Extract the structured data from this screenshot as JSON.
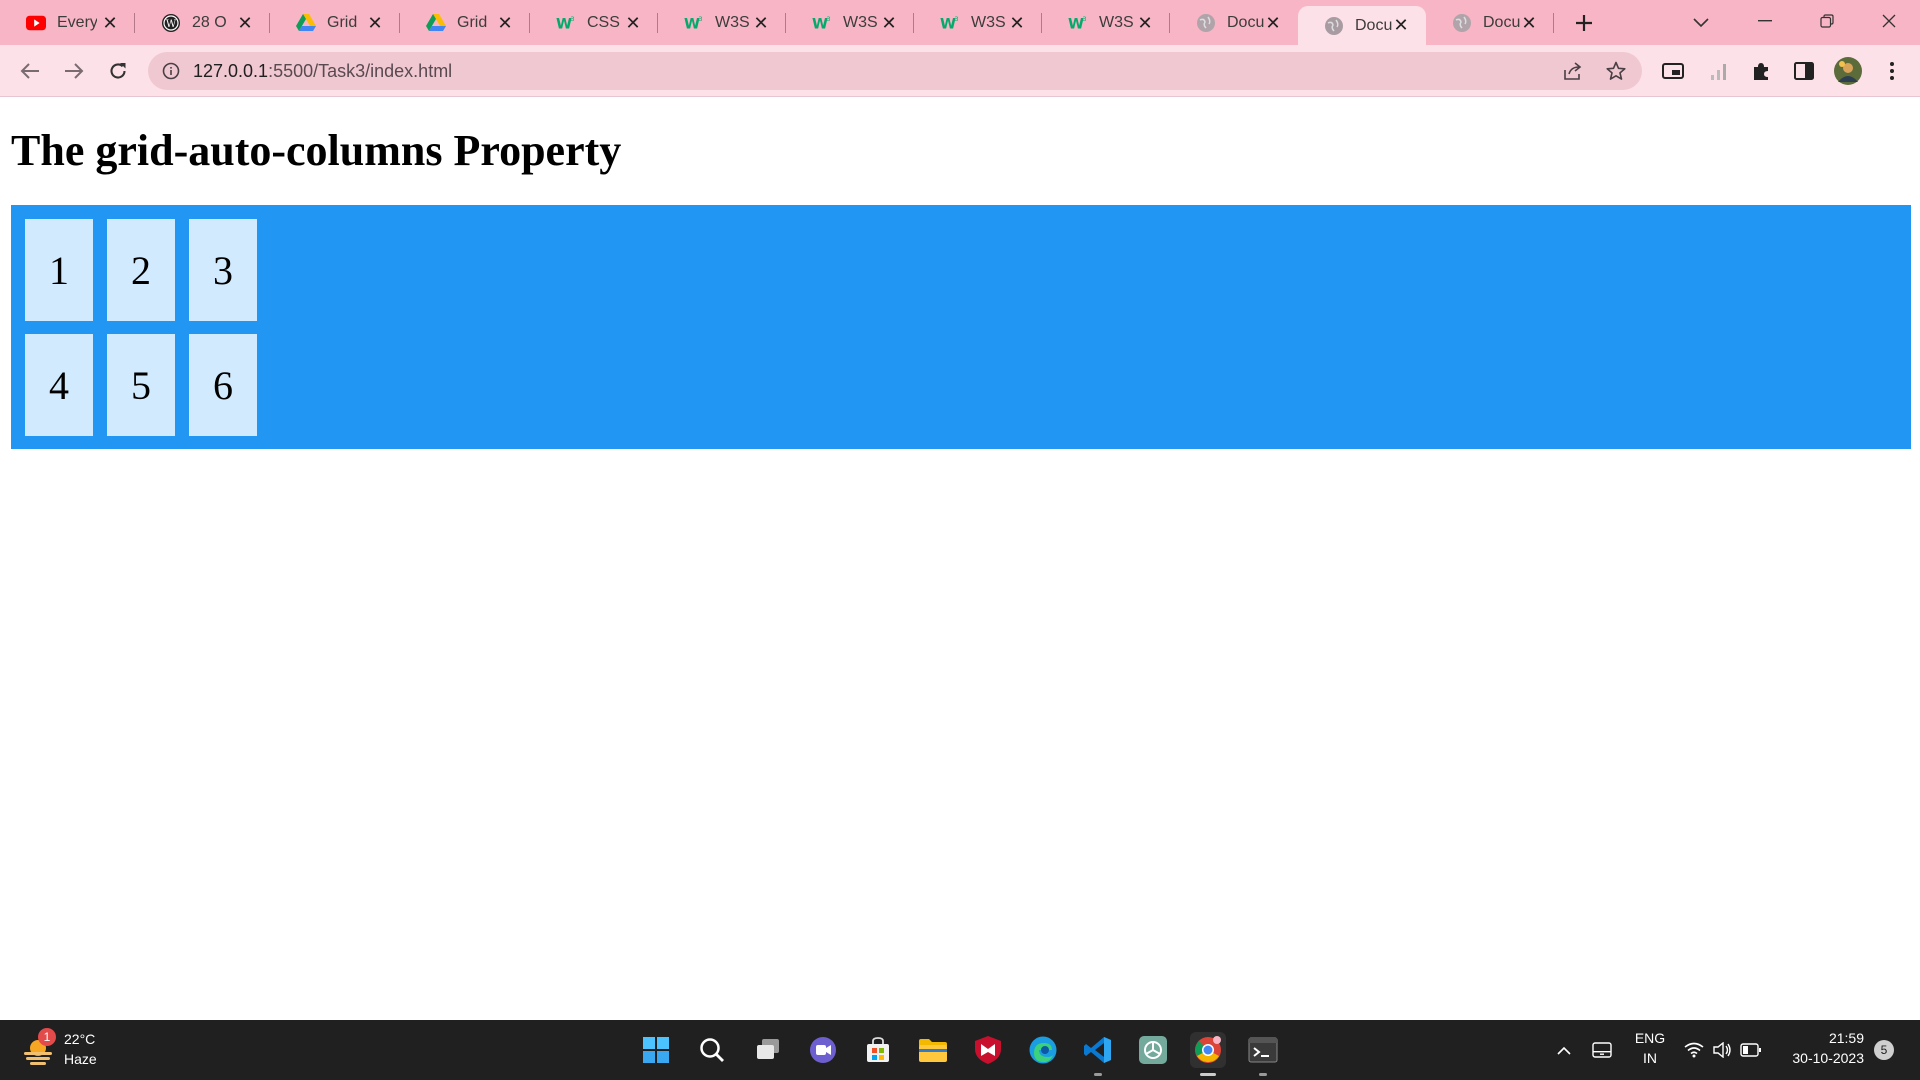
{
  "browser": {
    "tabs": [
      {
        "title": "Every",
        "icon": "youtube-icon"
      },
      {
        "title": "28 O",
        "icon": "wordpress-icon"
      },
      {
        "title": "Grid",
        "icon": "google-drive-icon"
      },
      {
        "title": "Grid",
        "icon": "google-drive-icon"
      },
      {
        "title": "CSS",
        "icon": "w3schools-icon"
      },
      {
        "title": "W3S",
        "icon": "w3schools-icon"
      },
      {
        "title": "W3S",
        "icon": "w3schools-icon"
      },
      {
        "title": "W3S",
        "icon": "w3schools-icon"
      },
      {
        "title": "W3S",
        "icon": "w3schools-icon"
      },
      {
        "title": "Docu",
        "icon": "globe-icon"
      },
      {
        "title": "Docu",
        "icon": "globe-icon",
        "active": true
      },
      {
        "title": "Docu",
        "icon": "globe-icon"
      }
    ],
    "address": {
      "host": "127.0.0.1",
      "rest": ":5500/Task3/index.html"
    }
  },
  "page": {
    "heading": "The grid-auto-columns Property",
    "grid_items": [
      "1",
      "2",
      "3",
      "4",
      "5",
      "6"
    ]
  },
  "taskbar": {
    "weather": {
      "temp": "22°C",
      "condition": "Haze",
      "badge": "1"
    },
    "language": {
      "lang": "ENG",
      "region": "IN"
    },
    "clock": {
      "time": "21:59",
      "date": "30-10-2023"
    },
    "notification_count": "5"
  },
  "colors": {
    "tab_strip": "#f7b5c5",
    "toolbar": "#fde1e8",
    "grid_container": "#2196f3",
    "grid_item": "rgba(255,255,255,0.8)",
    "taskbar": "#202020"
  }
}
